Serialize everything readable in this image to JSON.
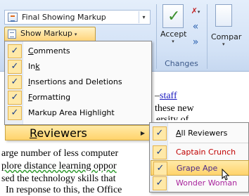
{
  "ribbon": {
    "display_mode_value": "Final Showing Markup",
    "show_markup_label": "Show Markup",
    "accept_label": "Accept",
    "compare_label": "Compar",
    "changes_group_label": "Changes"
  },
  "document": {
    "lines": [
      {
        "text": "these new",
        "prefix": ""
      },
      {
        "text": "arge number of less computer"
      },
      {
        "text": "plore distance learning oppor"
      },
      {
        "text": "sed the technology skills that"
      },
      {
        "text": "In response to this, the Office"
      }
    ],
    "link_text": "staff",
    "partial_text": "ersity of"
  },
  "show_markup_menu": {
    "items": [
      {
        "label": "Comments",
        "checked": true,
        "mnemonic": "C"
      },
      {
        "label": "Ink",
        "checked": true,
        "mnemonic": "k"
      },
      {
        "label": "Insertions and Deletions",
        "checked": true,
        "mnemonic": "I"
      },
      {
        "label": "Formatting",
        "checked": true,
        "mnemonic": "F"
      },
      {
        "label": "Markup Area Highlight",
        "checked": true,
        "mnemonic": ""
      },
      {
        "label": "Reviewers",
        "checked": false,
        "mnemonic": "R",
        "submenu": true
      }
    ]
  },
  "reviewers_menu": {
    "items": [
      {
        "label": "All Reviewers",
        "checked": true,
        "color": "#000000"
      },
      {
        "label": "Captain Crunch",
        "checked": true,
        "color": "#c00000"
      },
      {
        "label": "Grape Ape",
        "checked": true,
        "color": "#4b2a8c"
      },
      {
        "label": "Wonder Woman",
        "checked": true,
        "color": "#a8239c"
      }
    ]
  },
  "icons": {
    "check": "✓",
    "dropdown_arrow": "▾",
    "submenu_arrow": "▶",
    "prev": "«",
    "next": "»",
    "reject": "✗"
  }
}
